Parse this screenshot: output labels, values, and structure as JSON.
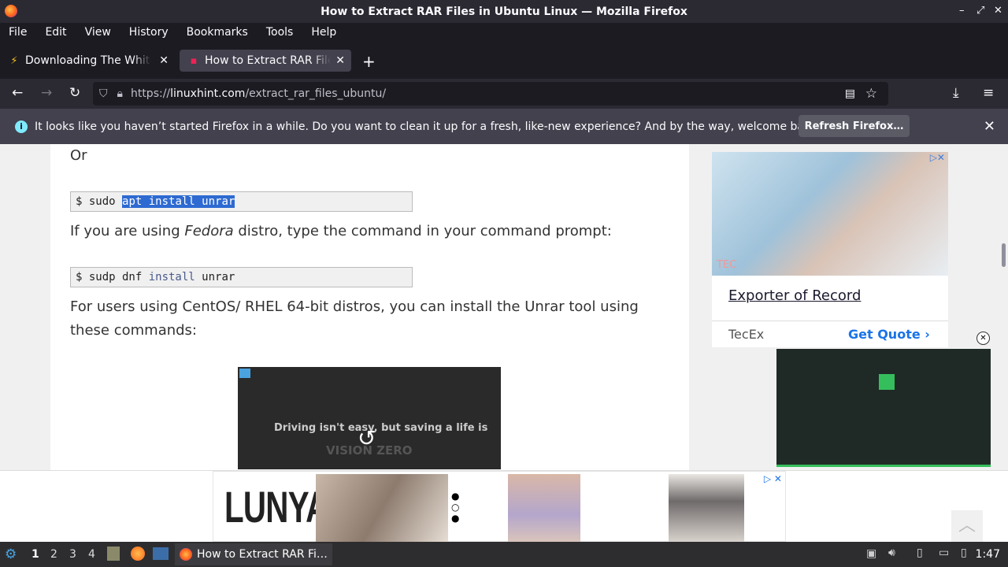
{
  "window": {
    "title": "How to Extract RAR Files in Ubuntu Linux — Mozilla Firefox",
    "controls": [
      "–",
      "⤢",
      "✕"
    ]
  },
  "menu": [
    "File",
    "Edit",
    "View",
    "History",
    "Bookmarks",
    "Tools",
    "Help"
  ],
  "tabs": [
    {
      "label": "Downloading The White House",
      "active": false
    },
    {
      "label": "How to Extract RAR Files in Ubuntu Linux",
      "active": true
    }
  ],
  "url": {
    "proto": "https://",
    "host": "linuxhint.com",
    "path": "/extract_rar_files_ubuntu/"
  },
  "notification": {
    "message": "It looks like you haven’t started Firefox in a while. Do you want to clean it up for a fresh, like-new experience? And by the way, welcome back!",
    "button": "Refresh Firefox…"
  },
  "article": {
    "or_text": "Or",
    "code1": {
      "prompt": "$ sudo ",
      "selected": "apt install unrar"
    },
    "fedora_pre": "If you are using ",
    "fedora_em": "Fedora",
    "fedora_post": " distro, type the command in your command prompt:",
    "code2": {
      "prompt": "$ sudp dnf ",
      "kw": "install",
      "rest": " unrar"
    },
    "centos_line1": "For users using CentOS/ RHEL 64-bit distros, you can install the Unrar tool using",
    "centos_line2": "these commands:",
    "video_caption": "Driving isn't easy, but saving a life is",
    "video_brand": "VISION ZERO"
  },
  "sidebar_ad": {
    "title": "Exporter of Record",
    "company": "TecEx",
    "cta": "Get Quote",
    "watermark": "TEC"
  },
  "bottom_ad": {
    "brand": "LUNYA"
  },
  "taskbar": {
    "workspaces": [
      "1",
      "2",
      "3",
      "4"
    ],
    "window_label": "How to Extract RAR Fi…",
    "clock": "1:47"
  }
}
